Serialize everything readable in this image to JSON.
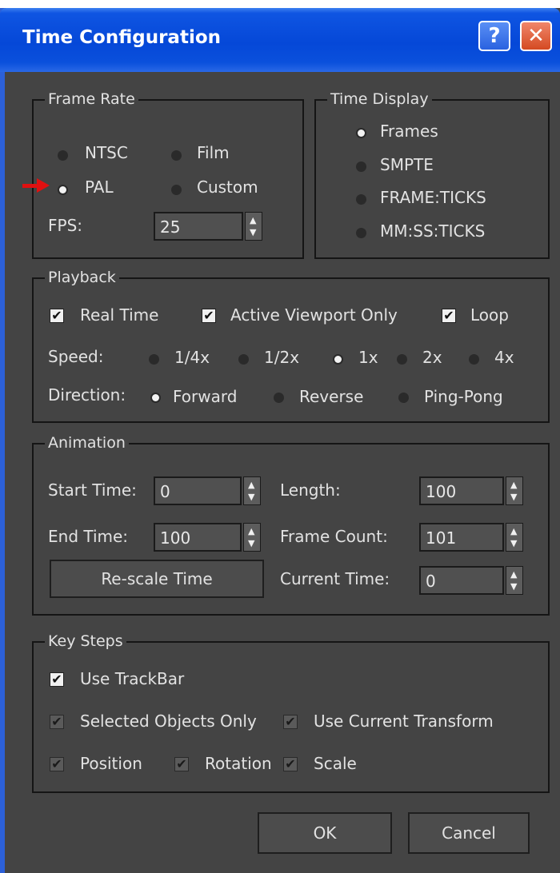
{
  "window": {
    "title": "Time Configuration",
    "help_glyph": "?",
    "close_glyph": "✕"
  },
  "frame_rate": {
    "legend": "Frame Rate",
    "options": [
      {
        "label": "NTSC",
        "selected": false
      },
      {
        "label": "Film",
        "selected": false
      },
      {
        "label": "PAL",
        "selected": true
      },
      {
        "label": "Custom",
        "selected": false
      }
    ],
    "fps_label": "FPS:",
    "fps_value": "25"
  },
  "time_display": {
    "legend": "Time Display",
    "options": [
      {
        "label": "Frames",
        "selected": true
      },
      {
        "label": "SMPTE",
        "selected": false
      },
      {
        "label": "FRAME:TICKS",
        "selected": false
      },
      {
        "label": "MM:SS:TICKS",
        "selected": false
      }
    ]
  },
  "playback": {
    "legend": "Playback",
    "real_time": {
      "label": "Real Time",
      "checked": true
    },
    "active_viewport": {
      "label": "Active Viewport Only",
      "checked": true
    },
    "loop": {
      "label": "Loop",
      "checked": true
    },
    "speed_label": "Speed:",
    "speeds": [
      {
        "label": "1/4x",
        "selected": false
      },
      {
        "label": "1/2x",
        "selected": false
      },
      {
        "label": "1x",
        "selected": true
      },
      {
        "label": "2x",
        "selected": false
      },
      {
        "label": "4x",
        "selected": false
      }
    ],
    "direction_label": "Direction:",
    "directions": [
      {
        "label": "Forward",
        "selected": true
      },
      {
        "label": "Reverse",
        "selected": false
      },
      {
        "label": "Ping-Pong",
        "selected": false
      }
    ]
  },
  "animation": {
    "legend": "Animation",
    "start_time_label": "Start Time:",
    "start_time": "0",
    "end_time_label": "End Time:",
    "end_time": "100",
    "length_label": "Length:",
    "length": "100",
    "frame_count_label": "Frame Count:",
    "frame_count": "101",
    "current_time_label": "Current Time:",
    "current_time": "0",
    "rescale_label": "Re-scale Time"
  },
  "key_steps": {
    "legend": "Key Steps",
    "use_trackbar": {
      "label": "Use TrackBar",
      "checked": true
    },
    "selected_objects_only": {
      "label": "Selected Objects Only",
      "checked": true
    },
    "use_current_transform": {
      "label": "Use Current Transform",
      "checked": true
    },
    "position": {
      "label": "Position",
      "checked": true
    },
    "rotation": {
      "label": "Rotation",
      "checked": true
    },
    "scale": {
      "label": "Scale",
      "checked": true
    }
  },
  "footer": {
    "ok_label": "OK",
    "cancel_label": "Cancel"
  },
  "colors": {
    "dialog_bg": "#444444",
    "titlebar": "#0548d8",
    "annotation_arrow": "#e01010"
  },
  "icons": {
    "check": "✔",
    "spin_up": "▲",
    "spin_down": "▼"
  }
}
